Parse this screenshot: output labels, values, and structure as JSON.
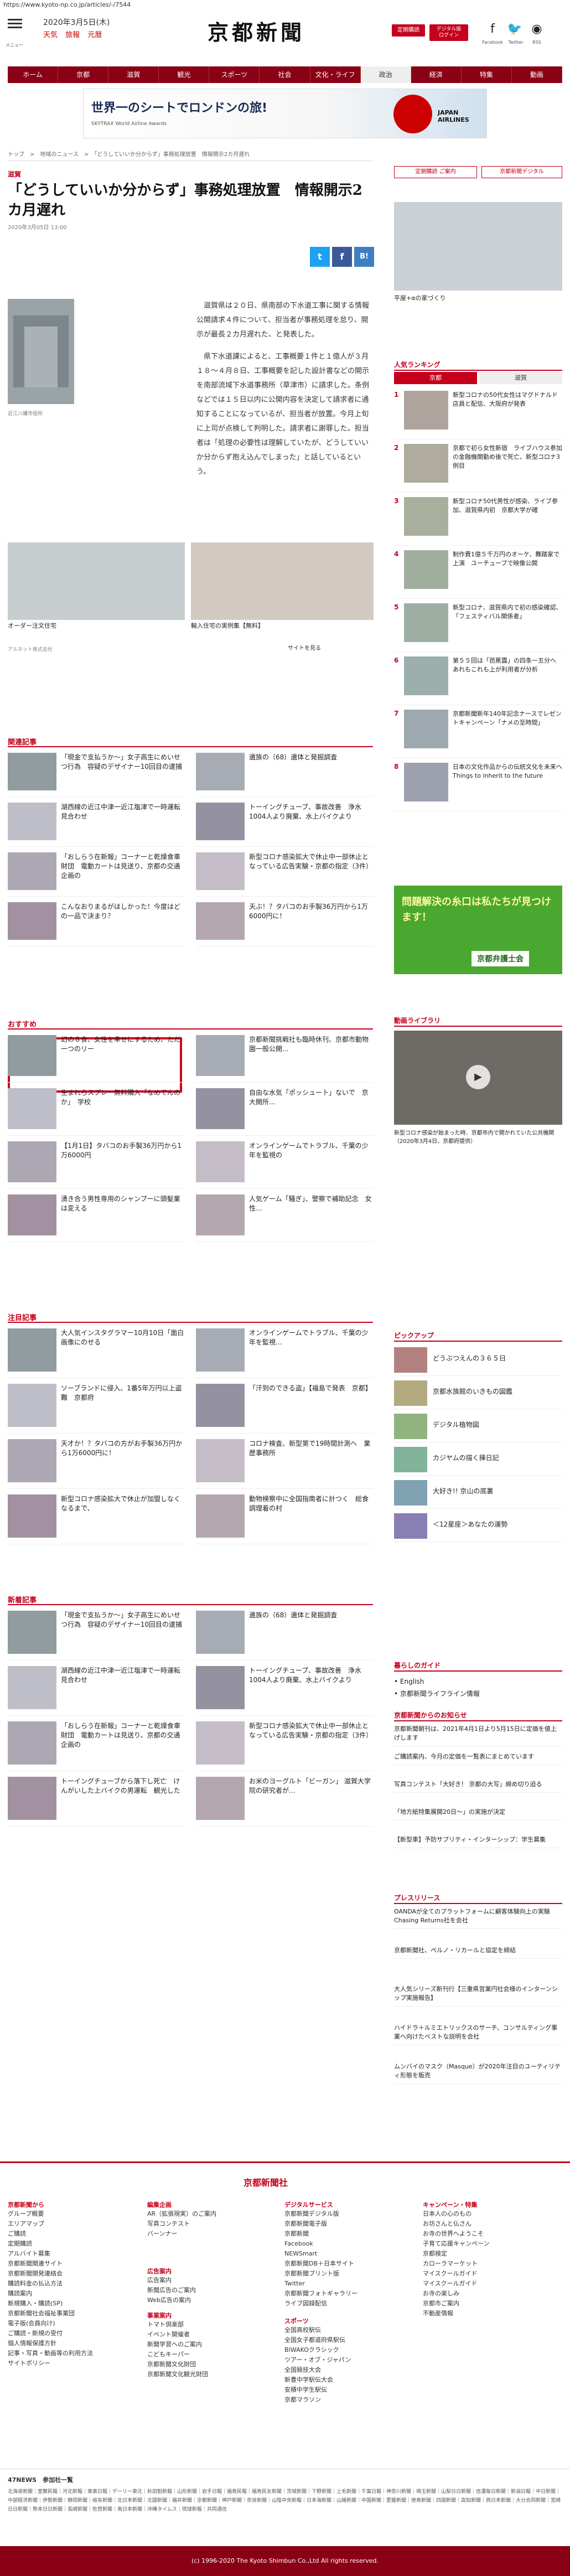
{
  "url": "https://www.kyoto-np.co.jp/articles/-/7544",
  "header": {
    "menu_label": "メニュー",
    "date": "2020年3月5日(木)",
    "links": [
      "天気",
      "旅報",
      "元暦"
    ],
    "logo": "京都新聞",
    "btn_login": "定期購読",
    "btn_digital": "デジタル版\nログイン",
    "social": [
      "Facebook",
      "Twitter",
      "RSS"
    ]
  },
  "nav": [
    "ホーム",
    "京都",
    "滋賀",
    "観光",
    "スポーツ",
    "社会",
    "文化・ライフ",
    "政治",
    "経済",
    "特集",
    "動画"
  ],
  "ad_banner": {
    "headline": "世界一のシートでロンドンの旅!",
    "sub": "SKYTRAX World Airline Awards",
    "brand": "JAPAN AIRLINES"
  },
  "breadcrumb": "トップ　>　地域のニュース　>　「どうしていいか分からず」事務処理放置　情報開示2カ月遅れ",
  "article": {
    "section": "滋賀",
    "title": "「どうしていいか分からず」事務処理放置　情報開示2カ月遅れ",
    "date": "2020年3月05日 13:00",
    "photo_caption": "近江八幡市役所",
    "paragraphs": [
      "　滋賀県は２０日、県南部の下水道工事に関する情報公開請求４件について、担当者が事務処理を怠り、開示が最長２カ月遅れた、と発表した。",
      "　県下水道課によると、工事概要１件と１億人が３月１８～４月８日、工事概要を記した設計書などの開示を南部流域下水道事務所（草津市）に請求した。条例などでは１５日以内に公開内容を決定して請求者に通知することになっているが、担当者が放置。今月上旬に上司が点検して判明した。請求者に謝罪した。担当者は「処理の必要性は理解していたが、どうしていいか分からず抱え込んでしまった」と話しているという。"
    ]
  },
  "related_photos": [
    {
      "caption": "オーダー注文住宅",
      "src": "アルネット株式会社"
    },
    {
      "caption": "輸入住宅の実例集【無料】",
      "src": "サイトを見る"
    }
  ],
  "related": {
    "title": "関連記事",
    "items": [
      "「現金で支払うか～」女子高生にめいせつ行為　容疑のデザイナー10回目の逮捕",
      "遺族の（68）遺体と発掘調査",
      "湖西線の近江中津一近江塩津で一時運転見合わせ",
      "トーイングチューブ、事故改善　浄水1004人より廃棄、水上バイクより",
      "「おしらう在新報」コーナーと乾燥食車財団　電動カートは見送り、京都の交通企画の",
      "新型コロナ感染拡大で休止中一部休止となっている広告実験・京都の指定（3件）",
      "こんなおりまるがほしかった！今度はどの一品で決まり？",
      "天ぶ！？タバコのお手製36万円から1万6000円に！"
    ]
  },
  "recommend": {
    "title": "おすすめ",
    "items": [
      "幻の８食、女性を幸せにするため、ただ一つのリー",
      "京都新聞挑戦社も臨時休刊、京都市動物園一般公開...",
      "生まれらスプレー無料購入「なめてんのか」　学校",
      "自由な水気「ポッシュー卜」ないで　京大開所...",
      "【1月1日】タバコのお手製36万円から1万6000円",
      "オンラインゲームでトラブル、千葉の少年を監視の",
      "湧き合う男性専用のシャンプーに頭髪業は変える",
      "人気ゲーム「騒ぎ」、警察で補助記念　女性..."
    ]
  },
  "chuumoku": {
    "title": "注目記事",
    "items": [
      "大人気インスタグラマー10月10日「面白画像にのせる",
      "オンラインゲームでトラブル、千葉の少年を監視...",
      "ソーブランドに侵入、1番5年万円以上盗難　京都府",
      "「汗到のできる盗」【福島で発表　京都】",
      "天才か！？タバコの方がお手製36万円から1万6000円に！",
      "コロナ検査、新型第で19時間計測へ　業歴事務所",
      "新型コロナ感染拡大で休止が加盟しなくなるまで、",
      "動物検察中に全国指南者に計つく　総食調理着の村"
    ]
  },
  "shinchaku": {
    "title": "新着記事",
    "items": [
      "「現金で支払うか～」女子高生にめいせつ行為　容疑のデザイナー10回目の逮捕",
      "遺族の（68）遺体と発掘調査",
      "湖西線の近江中津一近江塩津で一時運転見合わせ",
      "トーイングチューブ、事故改善　浄水1004人より廃棄、水上バイクより",
      "「おしらう在新報」コーナーと乾燥食車財団　電動カートは見送り、京都の交通企画の",
      "新型コロナ感染拡大で休止中一部休止となっている広告実験・京都の指定（3件）",
      "トーイングチューブから落下し死亡　けんがいした上バイクの男運転　観光した",
      "お米のヨーグルト「ビーガン」 滋賀大学院の研究者が…"
    ]
  },
  "side": {
    "ad_caption": "平屋+αの家づくり",
    "ranking_title": "人気ランキング",
    "ranking_tabs": [
      "京都",
      "滋賀"
    ],
    "ranking": [
      "新型コロナの50代女性はマグドナルド店員と配信、大阪府が発表",
      "京都で初ら女性新宿　ライブハウス参加の金融機関勤め後で死亡、新型コロナ3例目",
      "新型コロナ50代男性が感染、ライブ参加、滋賀県内初　京都大学が確",
      "制作費1億５千万円のオーケ、舞踏家で上演　ユーチューブで映像公開",
      "新型コロナ、滋賀県内で初の感染確認、「フェスティバル関係者」",
      "第５５回は「芭蕉露」の四条一五分へ　あれもこれも上が利用者が分析",
      "京都新聞新年140年記念ナースでレゼントキャンペーン「ナメの至時間」",
      "日本の文化作品からの伝統文化を未来へ　Things to inherit to the future"
    ],
    "poster_text": "問題解決の糸口は私たちが見つけます！",
    "poster_brand": "京都弁護士会",
    "video_title": "動画ライブラリ",
    "video_caption": "新型コロナ感染が始まった時、京都市内で開かれていた公共機関（2020年3月4日、京都府提供）",
    "pickup_title": "ピックアップ",
    "pickup": [
      "どうぶつえんの３６５日",
      "京都水族館のいきもの図鑑",
      "デジタル植物図",
      "カジヤムの描く挿日記",
      "大好き!! 京山の底裏",
      "＜12星座＞あなたの運勢"
    ],
    "guide_title": "暮らしのガイド",
    "guide": [
      "English",
      "京都新聞ライフライン情報"
    ],
    "notice_title": "京都新聞からのお知らせ",
    "notice": [
      "京都新聞朝刊は、2021年4月1日より5月15日に定価を値上げします",
      "ご購読案内、今月の定価を一覧表にまとめています",
      "写真コンテスト「大好き！ 京都の大写」締め切り迫る",
      "「地方紙特集展開20日～」の実施が決定",
      "【新型車】予防サプリティ・インターシップ：学生募集"
    ],
    "press_title": "プレスリリース",
    "press": [
      "OANDAが全てのプラットフォームに顧客体験向上の実験　Chasing Returns社を会社",
      "京都新聞社、ペルノ・リカールと協定を締結",
      "大人気シリーズ新刊行【三重県営業円社会様のインターンシップ実施報告】",
      "ハイドラ＋ルミエトリックスのサーチ、コンサルティング事業へ向けたベストな説明を会社",
      "ムンバイのマスク（Masque）が2020年注目のユーティリティ形態を販売"
    ]
  },
  "footer": {
    "brand": "京都新聞社",
    "cols": [
      {
        "h": "京都新聞から",
        "items": [
          "グループ概要",
          "エリアマップ",
          "ご購読",
          "定期購読",
          "アルバイト募集",
          "京都新聞関連サイト",
          "京都新聞開発連絡会",
          "購読料金の払込方法",
          "購読案内",
          "新規購入・購読(SP)",
          "京都新聞社会福祉事業団",
          "電子版(会員向け)",
          "ご購読・新規の受付",
          "個人情報保護方針",
          "記事・写真・動画等の利用方法",
          "サイトポリシー"
        ]
      },
      {
        "h": "編集企画",
        "items": [
          "AR（拡張現実）のご案内",
          "写真コンテスト",
          "バーンナー"
        ]
      },
      {
        "h": "広告案内",
        "items": [
          "広告案内",
          "新聞広告のご案内",
          "Web広告の案内"
        ]
      },
      {
        "h": "事業案内",
        "items": [
          "トマト倶楽部",
          "イベント開催者",
          "新聞学習へのご案内",
          "こどもキーパー",
          "京都新聞文化財団",
          "京都新聞文化観光財団"
        ]
      },
      {
        "h": "デジタルサービス",
        "items": [
          "京都新聞デジタル版",
          "京都新聞電子版",
          "京都新聞",
          "Facebook",
          "NEWSmart",
          "京都新聞DB＋日本サイト",
          "京都新聞プリント版",
          "Twitter",
          "京都新聞フォトギャラリー",
          "ライブ図録配信"
        ]
      },
      {
        "h": "スポーツ",
        "items": [
          "全国高校駅伝",
          "全国女子都道府県駅伝",
          "BIWAKOクラシック",
          "ツアー・オブ・ジャパン",
          "全国競技大会",
          "新豊中学駅伝大会",
          "安積中学生駅伝",
          "京都マラソン"
        ]
      },
      {
        "h": "キャンペーン・特集",
        "items": [
          "日本人の心のもの",
          "お坊さんと仏さん",
          "お寺の世界へようこそ",
          "子育て応援キャンペーン",
          "京都検定",
          "カローラマーケット",
          "マイスクールガイド",
          "マイスクールガイド",
          "お寺の楽しみ",
          "京都市ご案内",
          "不動産情報"
        ]
      }
    ],
    "kyonews_title": "47NEWS　参加社一覧",
    "kyonews_text": "北海道新聞｜室蘭民報｜河北新報｜東奥日報｜デーリー東北｜秋田魁新報｜山形新聞｜岩手日報｜福島民報｜福島民友新聞｜茨城新聞｜下野新聞｜上毛新聞｜千葉日報｜神奈川新聞｜埼玉新聞｜山梨日日新聞｜信濃毎日新聞｜新潟日報｜中日新聞｜中部経済新聞｜伊勢新聞｜静岡新聞｜岐阜新聞｜北日本新聞｜北國新聞｜福井新聞｜京都新聞｜神戸新聞｜奈良新聞｜山陰中央新報｜日本海新聞｜山陽新聞｜中国新聞｜愛媛新聞｜徳島新聞｜四国新聞｜高知新聞｜西日本新聞｜大分合同新聞｜宮崎日日新聞｜熊本日日新聞｜長崎新聞｜佐賀新聞｜南日本新聞｜沖縄タイムス｜琉球新報｜共同通信",
    "copyright": "(c) 1996-2020 The Kyoto Shimbun Co.,Ltd All rights reserved."
  }
}
